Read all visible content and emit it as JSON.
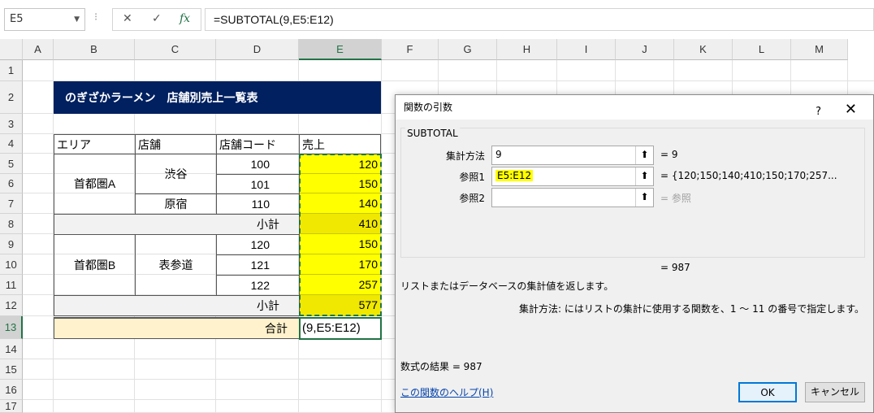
{
  "formula_bar": {
    "name_box": "E5",
    "cancel_icon": "✕",
    "enter_icon": "✓",
    "fx_icon": "fx",
    "formula": "=SUBTOTAL(9,E5:E12)"
  },
  "columns": [
    "A",
    "B",
    "C",
    "D",
    "E",
    "F",
    "G",
    "H",
    "I",
    "J",
    "K",
    "L",
    "M"
  ],
  "rows": [
    "1",
    "2",
    "3",
    "4",
    "5",
    "6",
    "7",
    "8",
    "9",
    "10",
    "11",
    "12",
    "13",
    "14",
    "15",
    "16",
    "17"
  ],
  "sheet": {
    "title": "のぎざかラーメン　店舗別売上一覧表",
    "headers": {
      "area": "エリア",
      "store": "店舗",
      "code": "店舗コード",
      "sales": "売上"
    },
    "area_a": "首都圏A",
    "area_b": "首都圏B",
    "store_shibuya": "渋谷",
    "store_harajuku": "原宿",
    "store_omotesando": "表参道",
    "codes": [
      "100",
      "101",
      "110",
      "120",
      "121",
      "122"
    ],
    "sales": [
      "120",
      "150",
      "140",
      "410",
      "150",
      "170",
      "257",
      "577"
    ],
    "subtotal_label": "小計",
    "total_label": "合計",
    "total_edit": "(9,E5:E12)"
  },
  "dialog": {
    "title": "関数の引数",
    "help_icon": "?",
    "close_icon": "✕",
    "function_name": "SUBTOTAL",
    "arg1_label": "集計方法",
    "arg1_value": "9",
    "arg1_result": "=  9",
    "arg2_label": "参照1",
    "arg2_value": "E5:E12",
    "arg2_result": "=  {120;150;140;410;150;170;257...",
    "arg3_label": "参照2",
    "arg3_value": "",
    "arg3_result": "=  参照",
    "formula_result_eq": "=  987",
    "description": "リストまたはデータベースの集計値を返します。",
    "arg_help": "集計方法:  にはリストの集計に使用する関数を、1 ～ 11 の番号で指定します。",
    "result_text": "数式の結果 =   987",
    "help_link": "この関数のヘルプ(H)",
    "ok": "OK",
    "cancel": "キャンセル"
  },
  "colors": {
    "title_bg": "#002060",
    "highlight": "#ffff00",
    "total_bg": "#fff2cc",
    "subtotal_bg": "#f2f2f2",
    "excel_green": "#217346"
  }
}
